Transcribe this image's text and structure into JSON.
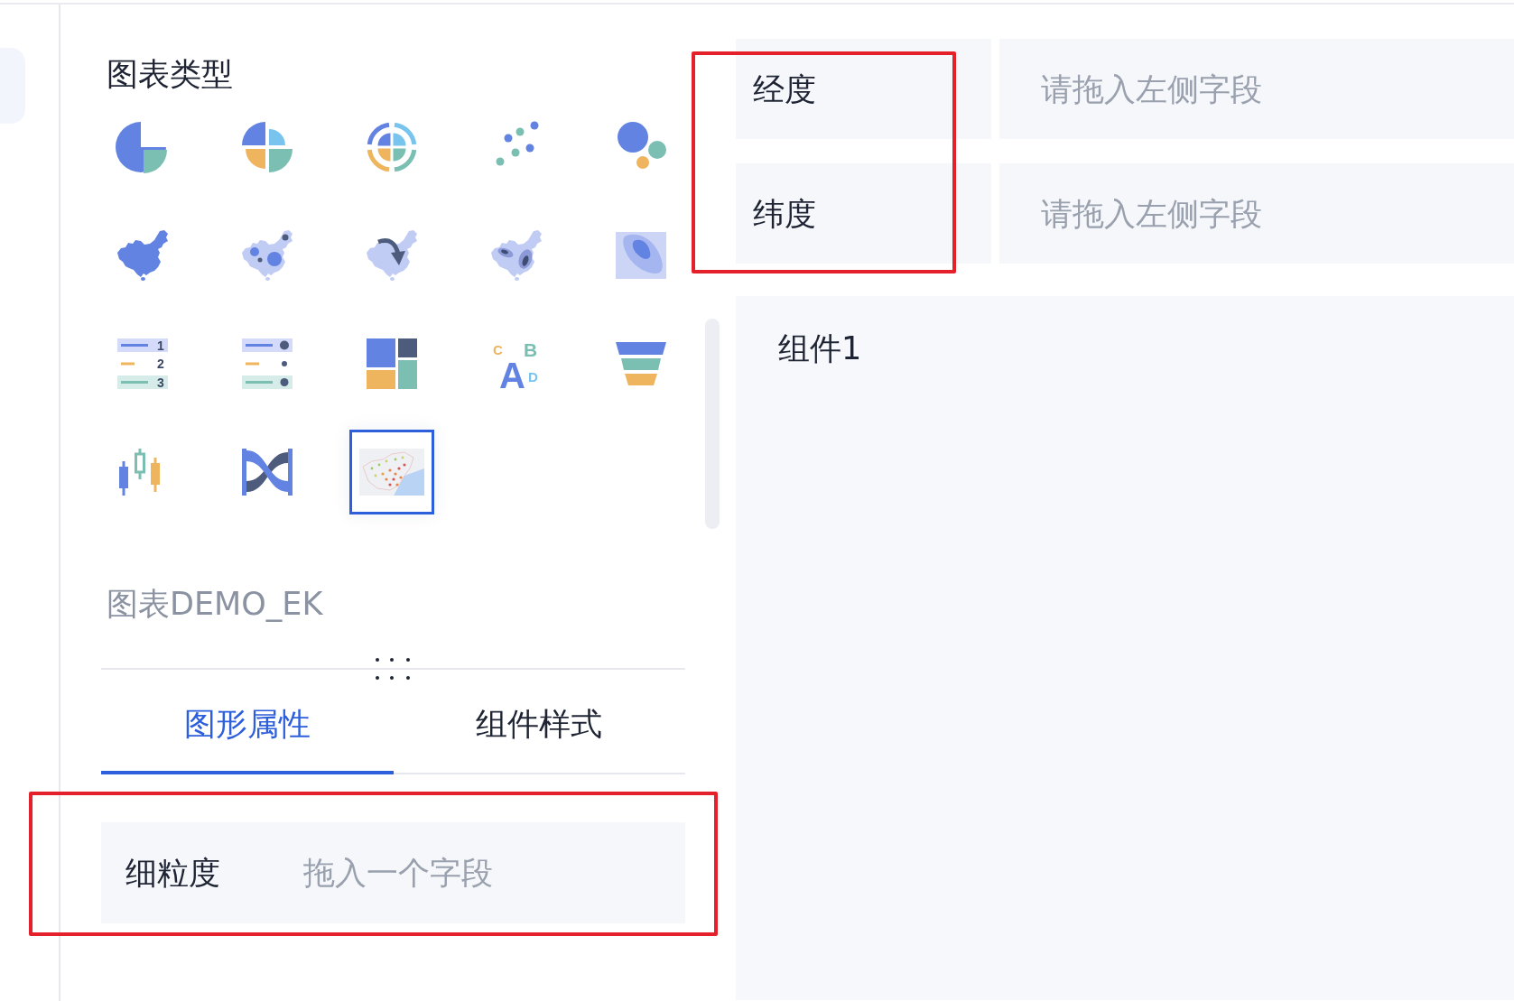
{
  "chart_type_panel": {
    "title": "图表类型",
    "chart_types": [
      {
        "kind": "pie",
        "selected": false
      },
      {
        "kind": "rose",
        "selected": false
      },
      {
        "kind": "sunburst",
        "selected": false
      },
      {
        "kind": "scatter",
        "selected": false
      },
      {
        "kind": "bubble",
        "selected": false
      },
      {
        "kind": "choropleth",
        "selected": false
      },
      {
        "kind": "bubblemap",
        "selected": false
      },
      {
        "kind": "flowmap",
        "selected": false
      },
      {
        "kind": "heatmap",
        "selected": false
      },
      {
        "kind": "density",
        "selected": false
      },
      {
        "kind": "ranking",
        "selected": false,
        "labels": [
          "1",
          "2",
          "3"
        ]
      },
      {
        "kind": "dotlist",
        "selected": false
      },
      {
        "kind": "treemap",
        "selected": false
      },
      {
        "kind": "wordcloud",
        "selected": false,
        "labels": [
          "C",
          "A",
          "B",
          "D"
        ]
      },
      {
        "kind": "funnel",
        "selected": false
      },
      {
        "kind": "candlestick",
        "selected": false
      },
      {
        "kind": "sankey",
        "selected": false
      },
      {
        "kind": "pointmap",
        "selected": true
      }
    ]
  },
  "chart_name": "图表DEMO_EK",
  "tabs": [
    {
      "label": "图形属性",
      "selected": true
    },
    {
      "label": "组件样式",
      "selected": false
    }
  ],
  "granularity_field": {
    "label": "细粒度",
    "placeholder": "拖入一个字段",
    "highlighted": true
  },
  "coordinate_fields": {
    "highlighted": true,
    "items": [
      {
        "label": "经度",
        "placeholder": "请拖入左侧字段"
      },
      {
        "label": "纬度",
        "placeholder": "请拖入左侧字段"
      }
    ]
  },
  "canvas": {
    "component_title": "组件1"
  }
}
